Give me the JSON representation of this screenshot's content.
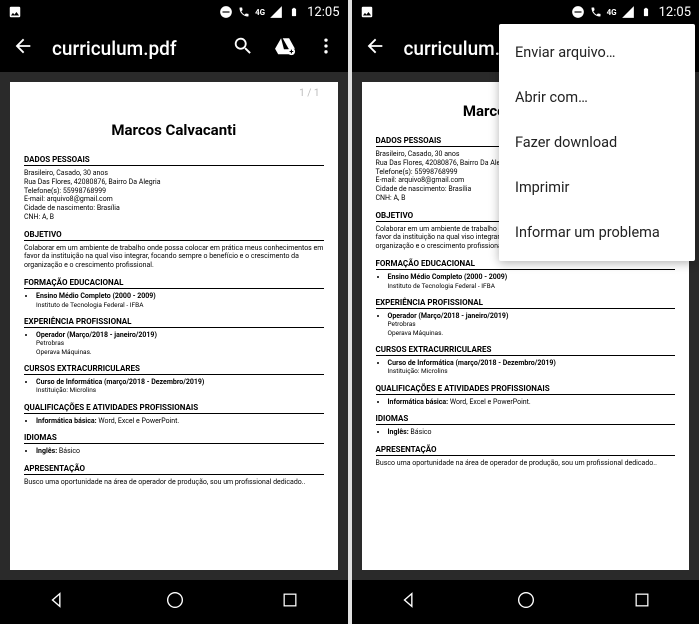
{
  "status": {
    "time": "12:05",
    "network_label": "4G"
  },
  "appbar": {
    "title": "curriculum.pdf"
  },
  "viewer": {
    "page_indicator": "1 / 1"
  },
  "resume": {
    "name": "Marcos Calvacanti",
    "sections": {
      "dados_pessoais": {
        "heading": "DADOS PESSOAIS",
        "lines": [
          "Brasileiro, Casado, 30 anos",
          "Rua Das Flores, 42080876, Bairro Da Alegria",
          "Telefone(s): 55998768999",
          "E-mail: arquivo8@gmail.com",
          "Cidade de nascimento: Brasília",
          "CNH: A, B"
        ]
      },
      "objetivo": {
        "heading": "OBJETIVO",
        "text": "Colaborar em um ambiente de trabalho onde possa colocar em prática meus conhecimentos em favor da instituição na qual viso integrar, focando sempre o benefício e o crescimento da organização e o crescimento profissional."
      },
      "formacao": {
        "heading": "FORMAÇÃO EDUCACIONAL",
        "item_title": "Ensino Médio Completo (2000 - 2009)",
        "item_sub": "Instituto de Tecnologia Federal - IFBA"
      },
      "experiencia": {
        "heading": "EXPERIÊNCIA PROFISSIONAL",
        "item_title": "Operador (Março/2018 - janeiro/2019)",
        "item_sub1": "Petrobras",
        "item_sub2": "Operava Máquinas."
      },
      "cursos": {
        "heading": "CURSOS EXTRACURRICULARES",
        "item_title": "Curso de Informática (março/2018 - Dezembro/2019)",
        "item_sub": "Instituição: Microlins"
      },
      "qualificacoes": {
        "heading": "QUALIFICAÇÕES E ATIVIDADES PROFISSIONAIS",
        "item_label": "Informática básica:",
        "item_rest": " Word, Excel e PowerPoint."
      },
      "idiomas": {
        "heading": "IDIOMAS",
        "item_label": "Inglês:",
        "item_rest": " Básico"
      },
      "apresentacao": {
        "heading": "APRESENTAÇÃO",
        "text": "Busco uma oportunidade na área de operador de produção, sou um profissional dedicado.."
      }
    }
  },
  "menu": {
    "items": [
      "Enviar arquivo…",
      "Abrir com…",
      "Fazer download",
      "Imprimir",
      "Informar um problema"
    ]
  }
}
